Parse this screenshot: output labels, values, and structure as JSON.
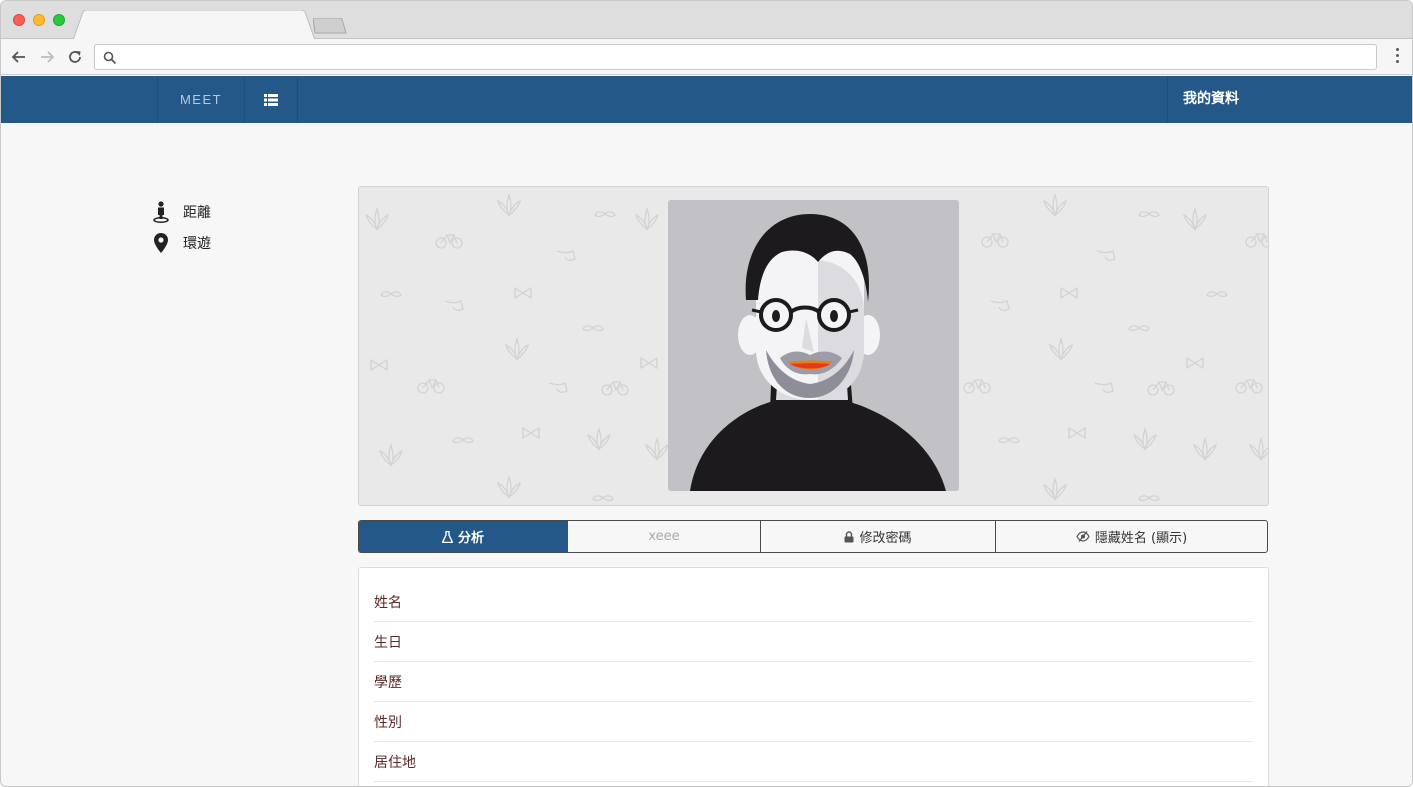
{
  "browser": {
    "address": ""
  },
  "navbar": {
    "brand": "MEET",
    "profile_label": "我的資料"
  },
  "sidebar": {
    "items": [
      {
        "label": "距離",
        "icon": "person-pin-icon"
      },
      {
        "label": "環遊",
        "icon": "map-marker-icon"
      }
    ]
  },
  "tabs": [
    {
      "label": "分析",
      "icon": "flask-icon"
    },
    {
      "label": "xeee"
    },
    {
      "label": "修改密碼",
      "icon": "lock-icon"
    },
    {
      "label": "隱藏姓名 (顯示)",
      "icon": "eye-slash-icon"
    }
  ],
  "info": {
    "fields": [
      "姓名",
      "生日",
      "學歷",
      "性別",
      "居住地"
    ]
  },
  "colors": {
    "nav": "#245889",
    "active_tab": "#245889"
  }
}
